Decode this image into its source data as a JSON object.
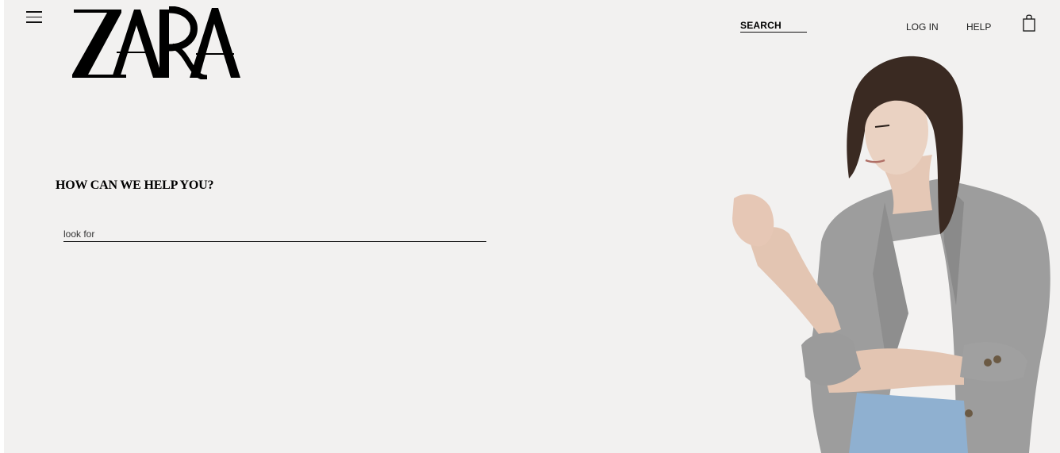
{
  "header": {
    "brand": "ZARA",
    "search_label": "SEARCH",
    "login_label": "LOG IN",
    "help_label": "HELP"
  },
  "help": {
    "title": "HOW CAN WE HELP YOU?",
    "search_placeholder": "look for"
  },
  "icons": {
    "menu": "hamburger-menu-icon",
    "bag": "shopping-bag-icon"
  },
  "colors": {
    "background": "#f2f1f0",
    "text": "#000000",
    "blazer": "#9a9a9a",
    "jeans": "#8fb0d0"
  }
}
